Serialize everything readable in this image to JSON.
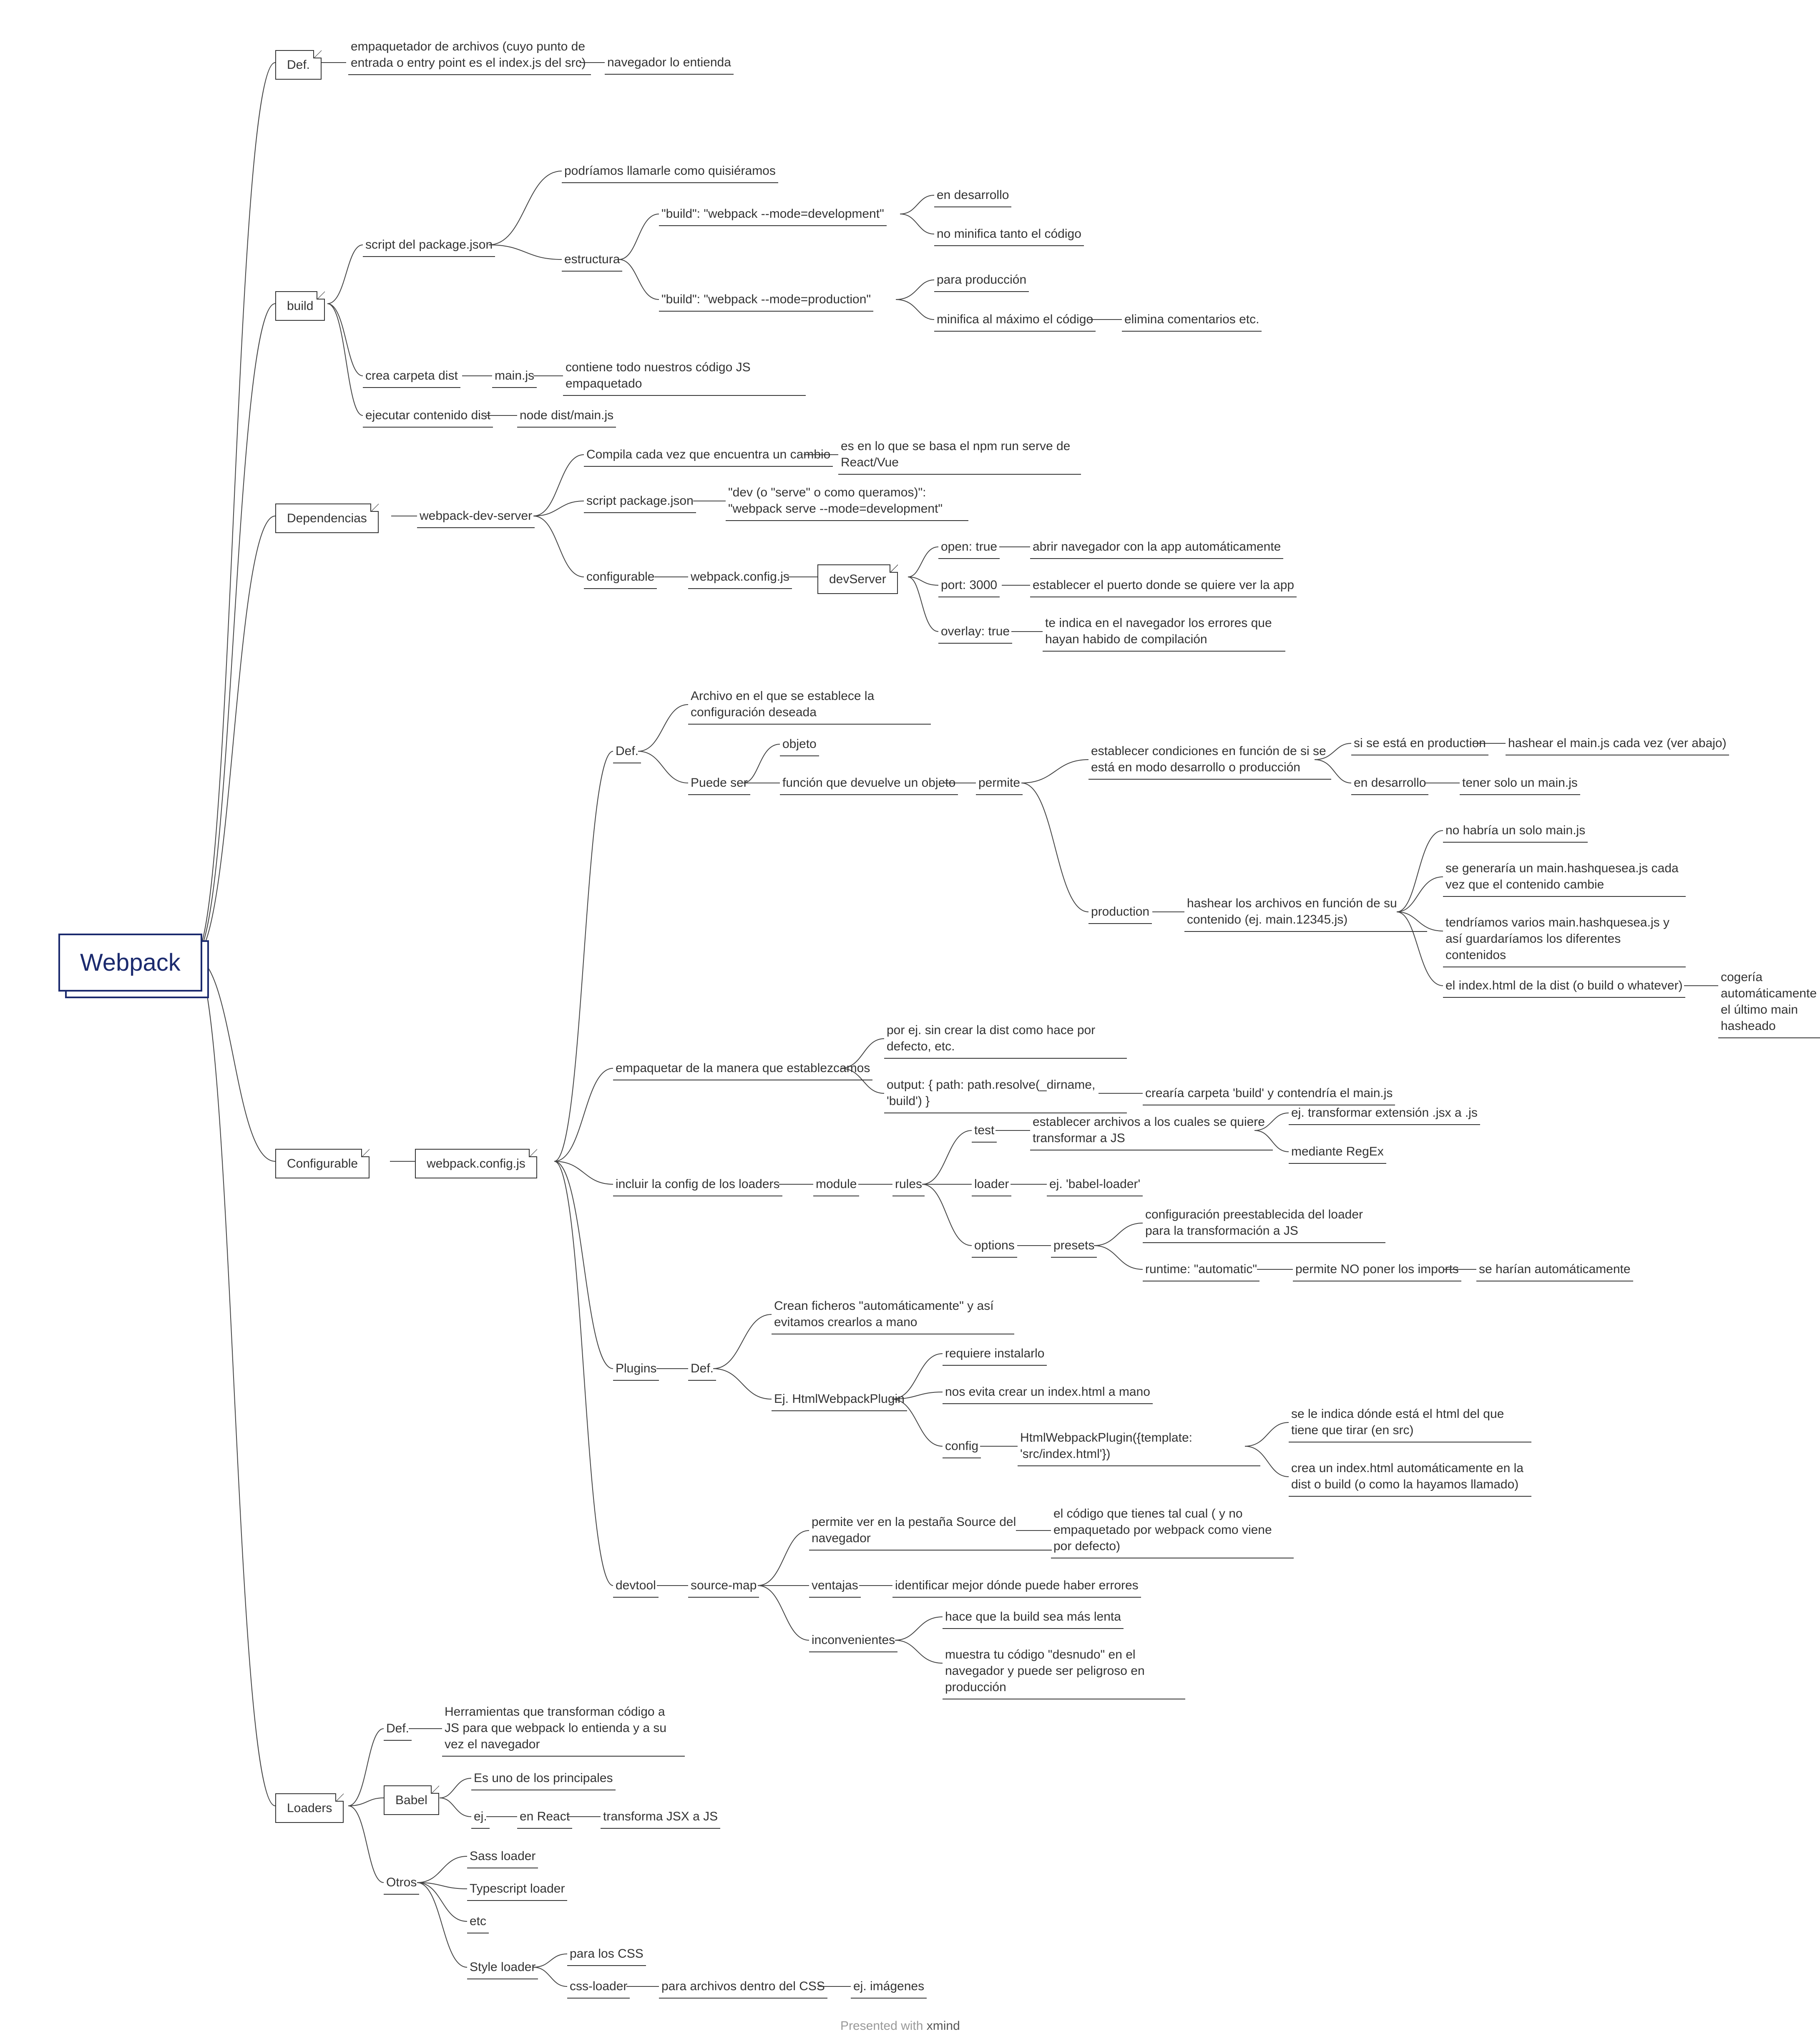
{
  "root": "Webpack",
  "footer_prefix": "Presented with ",
  "footer_brand": "xmind",
  "n": {
    "def": "Def.",
    "def_text": "empaquetador de archivos (cuyo punto de entrada o entry point es el index.js del src)",
    "def_child": "navegador lo entienda",
    "build": "build",
    "build_script": "script del package.json",
    "build_call": "podríamos llamarle como quisiéramos",
    "build_struct": "estructura",
    "build_dev": "\"build\": \"webpack --mode=development\"",
    "build_dev1": "en desarrollo",
    "build_dev2": "no minifica tanto el código",
    "build_prod": "\"build\": \"webpack --mode=production\"",
    "build_prod1": "para producción",
    "build_prod2": "minifica al máximo el código",
    "build_prod3": "elimina comentarios etc.",
    "build_dist": "crea carpeta dist",
    "build_main": "main.js",
    "build_main_desc": "contiene todo nuestros código JS empaquetado",
    "build_exec": "ejecutar contenido dist",
    "build_exec_cmd": "node dist/main.js",
    "deps": "Dependencias",
    "wds": "webpack-dev-server",
    "wds_comp": "Compila cada vez que encuentra un cambio",
    "wds_comp_e": "es en lo que se basa el npm run serve de React/Vue",
    "wds_script": "script package.json",
    "wds_script_v": "\"dev (o \"serve\" o como queramos)\": \"webpack serve --mode=development\"",
    "wds_conf": "configurable",
    "wds_file": "webpack.config.js",
    "devServer": "devServer",
    "ds_open": "open: true",
    "ds_open_d": "abrir navegador con la app automáticamente",
    "ds_port": "port: 3000",
    "ds_port_d": "establecer el puerto donde se quiere ver la app",
    "ds_overlay": "overlay: true",
    "ds_overlay_d": "te indica en el navegador los errores que hayan habido de compilación",
    "conf": "Configurable",
    "conf_file": "webpack.config.js",
    "cf_def": "Def.",
    "cf_def_t": "Archivo en el que se establece la configuración deseada",
    "cf_can": "Puede ser",
    "cf_obj": "objeto",
    "cf_fn": "función que devuelve un objeto",
    "cf_perm": "permite",
    "cf_perm1": "establecer condiciones en función de si se está en modo desarrollo o producción",
    "cf_perm1a": "si se está en production",
    "cf_perm1a1": "hashear el main.js cada vez (ver abajo)",
    "cf_perm1b": "en desarrollo",
    "cf_perm1b1": "tener solo un main.js",
    "cf_prod": "production",
    "cf_prod_h": "hashear los archivos en función de su contenido (ej. main.12345.js)",
    "cf_prod1": "no habría un solo main.js",
    "cf_prod2": "se generaría un main.hashquesea.js cada vez que el contenido cambie",
    "cf_prod3": "tendríamos varios main.hashquesea.js y así guardaríamos los diferentes contenidos",
    "cf_prod4": "el index.html de la dist (o build o whatever)",
    "cf_prod4a": "cogería automáticamente el último main hasheado",
    "pack": "empaquetar de la manera que establezcamos",
    "pack_e1": "por ej. sin crear la dist como hace por defecto, etc.",
    "pack_out": "output: { path: path.resolve(_dirname, 'build') }",
    "pack_out_d": "crearía carpeta 'build' y contendría el main.js",
    "inc": "incluir la config de los loaders",
    "inc_mod": "module",
    "inc_rules": "rules",
    "r_test": "test",
    "r_test_d": "establecer archivos a los cuales se quiere transformar a JS",
    "r_test_e1": "ej. transformar extensión .jsx a .js",
    "r_test_e2": "mediante RegEx",
    "r_loader": "loader",
    "r_loader_e": "ej. 'babel-loader'",
    "r_opt": "options",
    "r_presets": "presets",
    "r_presets1": "configuración preestablecida del loader para la transformación a JS",
    "r_presets2": "runtime: \"automatic\"",
    "r_presets2a": "permite NO poner los imports",
    "r_presets2b": "se harían automáticamente",
    "plugins": "Plugins",
    "pl_def": "Def.",
    "pl_def_t": "Crean ficheros \"automáticamente\" y así evitamos crearlos a mano",
    "pl_ex": "Ej. HtmlWebpackPlugin",
    "pl_ex1": "requiere instalarlo",
    "pl_ex2": "nos evita crear un index.html a mano",
    "pl_cfg": "config",
    "pl_cfg_t": "HtmlWebpackPlugin({template: 'src/index.html'})",
    "pl_cfg1": "se le indica dónde está el html del que tiene que tirar (en src)",
    "pl_cfg2": "crea un index.html automáticamente en la dist o build (o como la hayamos llamado)",
    "dev": "devtool",
    "dev_sm": "source-map",
    "sm1": "permite ver en la pestaña Source del navegador",
    "sm1a": "el código que tienes tal cual ( y no empaquetado por webpack como viene por defecto)",
    "sm_v": "ventajas",
    "sm_v1": "identificar mejor dónde puede haber errores",
    "sm_i": "inconvenientes",
    "sm_i1": "hace que la build sea más lenta",
    "sm_i2": "muestra tu código \"desnudo\" en el navegador y puede ser peligroso en producción",
    "load": "Loaders",
    "ld_def": "Def.",
    "ld_def_t": "Herramientas que transforman código a JS para que webpack lo entienda y a su vez el navegador",
    "babel": "Babel",
    "bab1": "Es uno de los principales",
    "bab_ej": "ej.",
    "bab_react": "en React",
    "bab_t": "transforma JSX a JS",
    "otros": "Otros",
    "ot1": "Sass loader",
    "ot2": "Typescript loader",
    "ot3": "etc",
    "ot4": "Style loader",
    "ot4a": "para los CSS",
    "ot4b": "css-loader",
    "ot4b1": "para archivos dentro del CSS",
    "ot4b2": "ej. imágenes"
  }
}
